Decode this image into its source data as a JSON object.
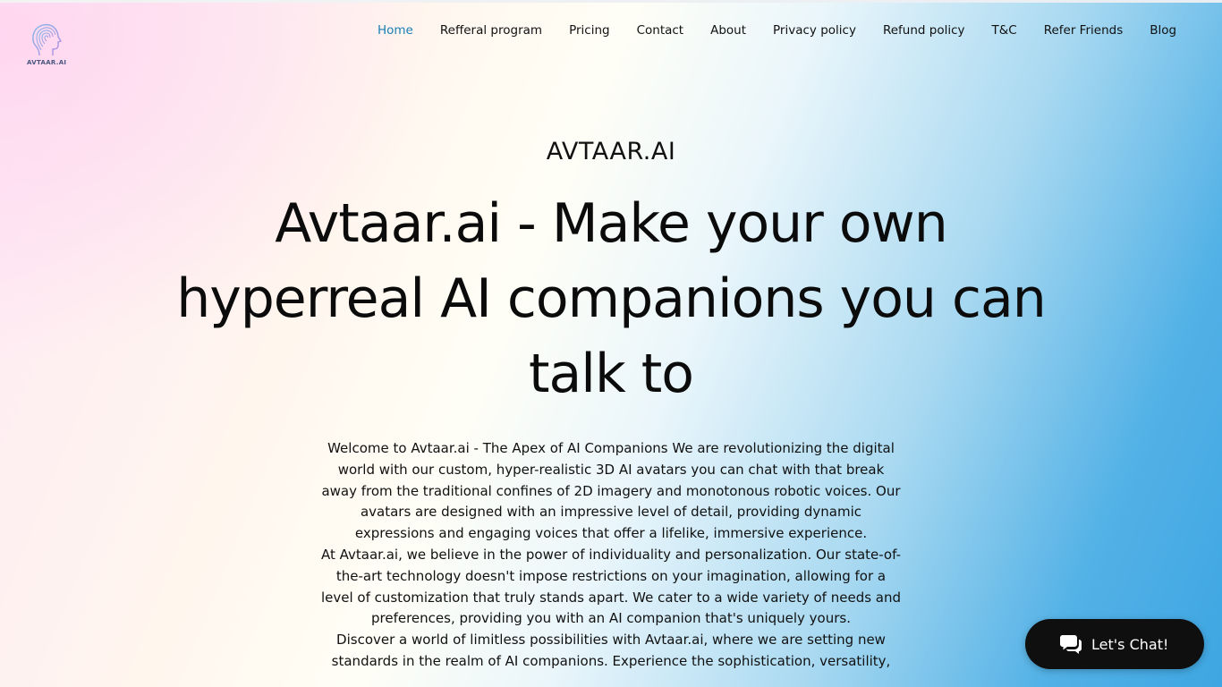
{
  "brand": {
    "logo_text": "AVTAAR.AI",
    "logo_icon": "head-profile-icon",
    "accent_color": "#1a7fb5"
  },
  "nav": {
    "items": [
      {
        "label": "Home",
        "active": true
      },
      {
        "label": "Refferal program",
        "active": false
      },
      {
        "label": "Pricing",
        "active": false
      },
      {
        "label": "Contact",
        "active": false
      },
      {
        "label": "About",
        "active": false
      },
      {
        "label": "Privacy policy",
        "active": false
      },
      {
        "label": "Refund policy",
        "active": false
      },
      {
        "label": "T&C",
        "active": false
      },
      {
        "label": "Refer Friends",
        "active": false
      },
      {
        "label": "Blog",
        "active": false
      }
    ]
  },
  "hero": {
    "brand_title": "AVTAAR.AI",
    "headline": "Avtaar.ai - Make your own hyperreal AI companions you can talk to",
    "paragraphs": [
      "Welcome to Avtaar.ai - The Apex of AI Companions  We are revolutionizing the digital world with our custom, hyper-realistic 3D AI avatars you can chat with that break away from the traditional confines of 2D imagery and monotonous robotic voices. Our avatars are designed with an impressive level of detail, providing dynamic expressions and engaging voices that offer a lifelike, immersive experience.",
      "At Avtaar.ai, we believe in the power of individuality and personalization. Our state-of-the-art technology doesn't impose restrictions on your imagination, allowing for a level of customization that truly stands apart. We cater to a wide variety of needs and preferences, providing you with an AI companion that's uniquely yours.",
      "Discover a world of limitless possibilities with Avtaar.ai, where we are setting new standards in the realm of AI companions. Experience the sophistication, versatility,"
    ]
  },
  "chat": {
    "label": "Let's Chat!",
    "icon": "chat-bubbles-icon",
    "background_color": "#0f0f0f"
  }
}
